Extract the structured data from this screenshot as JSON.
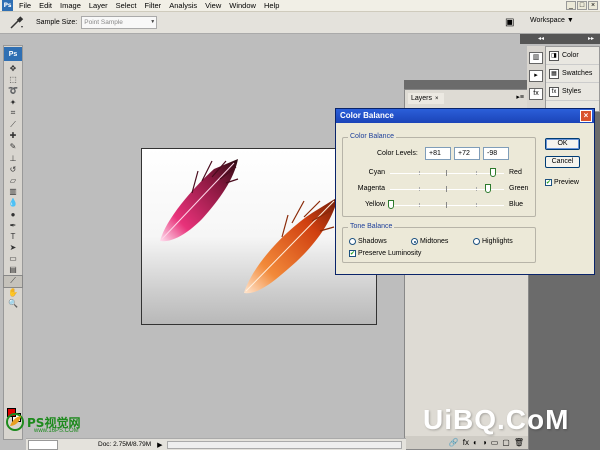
{
  "app": {
    "logo_small": "Ps",
    "workspace_label": "Workspace ▼"
  },
  "menu": [
    "File",
    "Edit",
    "Image",
    "Layer",
    "Select",
    "Filter",
    "Analysis",
    "View",
    "Window",
    "Help"
  ],
  "window_controls": [
    "_",
    "□",
    "×"
  ],
  "options_bar": {
    "sample_size_label": "Sample Size:",
    "sample_size_value": "Point Sample"
  },
  "toolbox": {
    "logo": "Ps",
    "tools": [
      {
        "name": "move-tool-icon",
        "glyph": "✥"
      },
      {
        "name": "marquee-tool-icon",
        "glyph": "⬚"
      },
      {
        "name": "lasso-tool-icon",
        "glyph": "➰"
      },
      {
        "name": "magic-wand-tool-icon",
        "glyph": "✦"
      },
      {
        "name": "crop-tool-icon",
        "glyph": "⌗"
      },
      {
        "name": "slice-tool-icon",
        "glyph": "⟋"
      },
      {
        "name": "healing-brush-tool-icon",
        "glyph": "✚"
      },
      {
        "name": "brush-tool-icon",
        "glyph": "✎"
      },
      {
        "name": "clone-stamp-tool-icon",
        "glyph": "⊥"
      },
      {
        "name": "history-brush-tool-icon",
        "glyph": "↺"
      },
      {
        "name": "eraser-tool-icon",
        "glyph": "▱"
      },
      {
        "name": "gradient-tool-icon",
        "glyph": "▥"
      },
      {
        "name": "blur-tool-icon",
        "glyph": "💧"
      },
      {
        "name": "dodge-tool-icon",
        "glyph": "●"
      },
      {
        "name": "pen-tool-icon",
        "glyph": "✒"
      },
      {
        "name": "type-tool-icon",
        "glyph": "T"
      },
      {
        "name": "path-selection-tool-icon",
        "glyph": "➤"
      },
      {
        "name": "shape-tool-icon",
        "glyph": "▭"
      },
      {
        "name": "notes-tool-icon",
        "glyph": "▤"
      },
      {
        "name": "eyedropper-tool-icon",
        "glyph": "⟋",
        "active": true
      },
      {
        "name": "hand-tool-icon",
        "glyph": "✋"
      },
      {
        "name": "zoom-tool-icon",
        "glyph": "🔍"
      }
    ],
    "foreground_color": "#e00000",
    "background_color": "#ffffff"
  },
  "status_bar": {
    "doc_size": "Doc: 2.75M/8.79M",
    "arrow": "▶"
  },
  "layers_panel": {
    "tab_label": "Layers",
    "close": "×",
    "menu": "▸≡",
    "footer_icons": [
      "🔗",
      "fx",
      "◐",
      "◑",
      "▭",
      "▢",
      "🗑"
    ]
  },
  "dock": {
    "collapse_left": "◂◂",
    "collapse_right": "▸▸",
    "strip_icons": [
      "▥",
      "▸",
      "fx"
    ],
    "panels": [
      {
        "label": "Color",
        "icon": "◨"
      },
      {
        "label": "Swatches",
        "icon": "▦"
      },
      {
        "label": "Styles",
        "icon": "fx"
      }
    ]
  },
  "dialog": {
    "title": "Color Balance",
    "close": "×",
    "color_balance_group": "Color Balance",
    "color_levels_label": "Color Levels:",
    "levels": [
      "+81",
      "+72",
      "-98"
    ],
    "sliders": [
      {
        "left": "Cyan",
        "right": "Red",
        "value": 81
      },
      {
        "left": "Magenta",
        "right": "Green",
        "value": 72
      },
      {
        "left": "Yellow",
        "right": "Blue",
        "value": -98
      }
    ],
    "tone_balance_group": "Tone Balance",
    "tones": [
      {
        "label": "Shadows",
        "selected": false
      },
      {
        "label": "Midtones",
        "selected": true
      },
      {
        "label": "Highlights",
        "selected": false
      }
    ],
    "preserve_luminosity_label": "Preserve Luminosity",
    "preserve_luminosity": true,
    "ok_label": "OK",
    "cancel_label": "Cancel",
    "preview_label": "Preview",
    "preview": true
  },
  "watermarks": {
    "left_text": "PS视觉网",
    "left_url": "www.16PS.COM",
    "right_text": "UiBQ.CoM"
  },
  "colors": {
    "accent_title": "#1b44b8",
    "group_label": "#1d3f9a",
    "watermark_green": "#1d8a1d"
  }
}
